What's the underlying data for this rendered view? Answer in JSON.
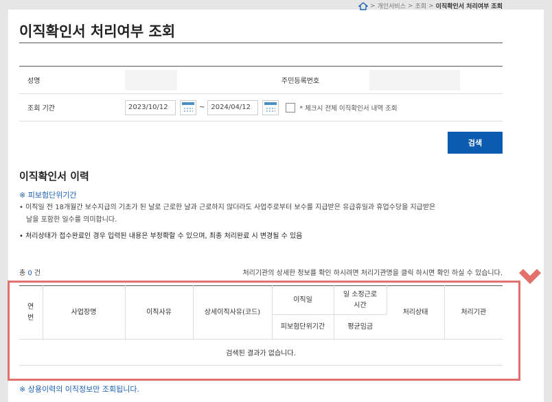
{
  "breadcrumb": {
    "items": [
      "개인서비스",
      "조회"
    ],
    "current": "이직확인서 처리여부 조회"
  },
  "page_title": "이직확인서 처리여부 조회",
  "form": {
    "name_label": "성명",
    "ssn_label": "주민등록번호",
    "period_label": "조회 기간",
    "date_from": "2023/10/12",
    "date_sep": "~",
    "date_to": "2024/04/12",
    "all_check_label": "* 체크시 전체 이직확인서 내역 조회"
  },
  "search_button": "검색",
  "history": {
    "title": "이직확인서 이력",
    "note_head": "※ 피보험단위기간",
    "note_1": "• 이직일 전 18개월간 보수지급의 기초가 된 날로 근로한 날과 근로하지 않더라도 사업주로부터 보수를 지급받은 유급휴일과 휴업수당을 지급받은",
    "note_1b": "날을 포함한 일수를 의미합니다.",
    "note_2": "• 처리상태가 접수완료인 경우 입력된 내용은 부정확할 수 있으며, 최종 처리완료 시 변경될 수 있음",
    "count_prefix": "총",
    "count_value": "0",
    "count_suffix": "건",
    "hint": "처리기관의 상세한 정보를 확인 하시려면 처리기관명을 클릭 하시면 확인 하실 수 있습니다."
  },
  "table": {
    "col_no": "연번",
    "col_company": "사업장명",
    "col_reason": "이직사유",
    "col_reason_detail": "상세이직사유(코드)",
    "col_leave_date": "이직일",
    "col_insured_period": "피보험단위기간",
    "col_work_hours": "일 소정근로\n시간",
    "col_avg_wage": "평균임금",
    "col_status": "처리상태",
    "col_agency": "처리기관",
    "empty_message": "검색된 결과가 없습니다."
  },
  "footer_note": "※ 상용이력의 이직정보만 조회됩니다.",
  "colors": {
    "accent": "#0b5cb0",
    "highlight": "#e2706b",
    "link": "#1a5fb4"
  }
}
